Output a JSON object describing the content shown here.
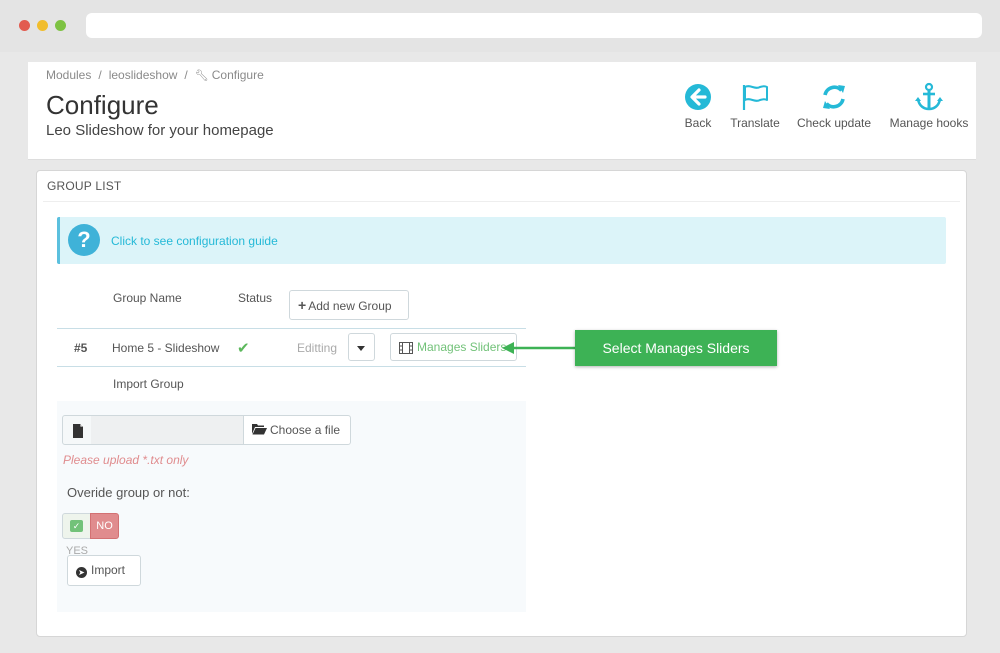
{
  "browser": {},
  "breadcrumb": {
    "items": [
      "Modules",
      "leoslideshow",
      "Configure"
    ],
    "separator": "/"
  },
  "header": {
    "title": "Configure",
    "subtitle": "Leo Slideshow for your homepage"
  },
  "toolbar": {
    "back": "Back",
    "translate": "Translate",
    "check_update": "Check update",
    "manage_hooks": "Manage hooks"
  },
  "panel": {
    "heading": "GROUP LIST",
    "guide_link": "Click to see configuration guide",
    "columns": {
      "group_name": "Group Name",
      "status": "Status"
    },
    "add_button": "Add new Group",
    "row": {
      "id": "#5",
      "name": "Home 5 - Slideshow",
      "editing": "Editting",
      "manage_button": "Manages Sliders"
    },
    "import": {
      "label": "Import Group",
      "choose_button": "Choose a file",
      "hint": "Please upload *.txt only",
      "override_label": "Overide group or not:",
      "no_label": "NO",
      "yes_label": "YES",
      "import_button": "Import"
    }
  },
  "callout": {
    "text": "Select Manages Sliders"
  },
  "colors": {
    "accent": "#25b9d7",
    "callout": "#3db255",
    "no_switch": "#e08c8e",
    "success": "#72c279"
  }
}
